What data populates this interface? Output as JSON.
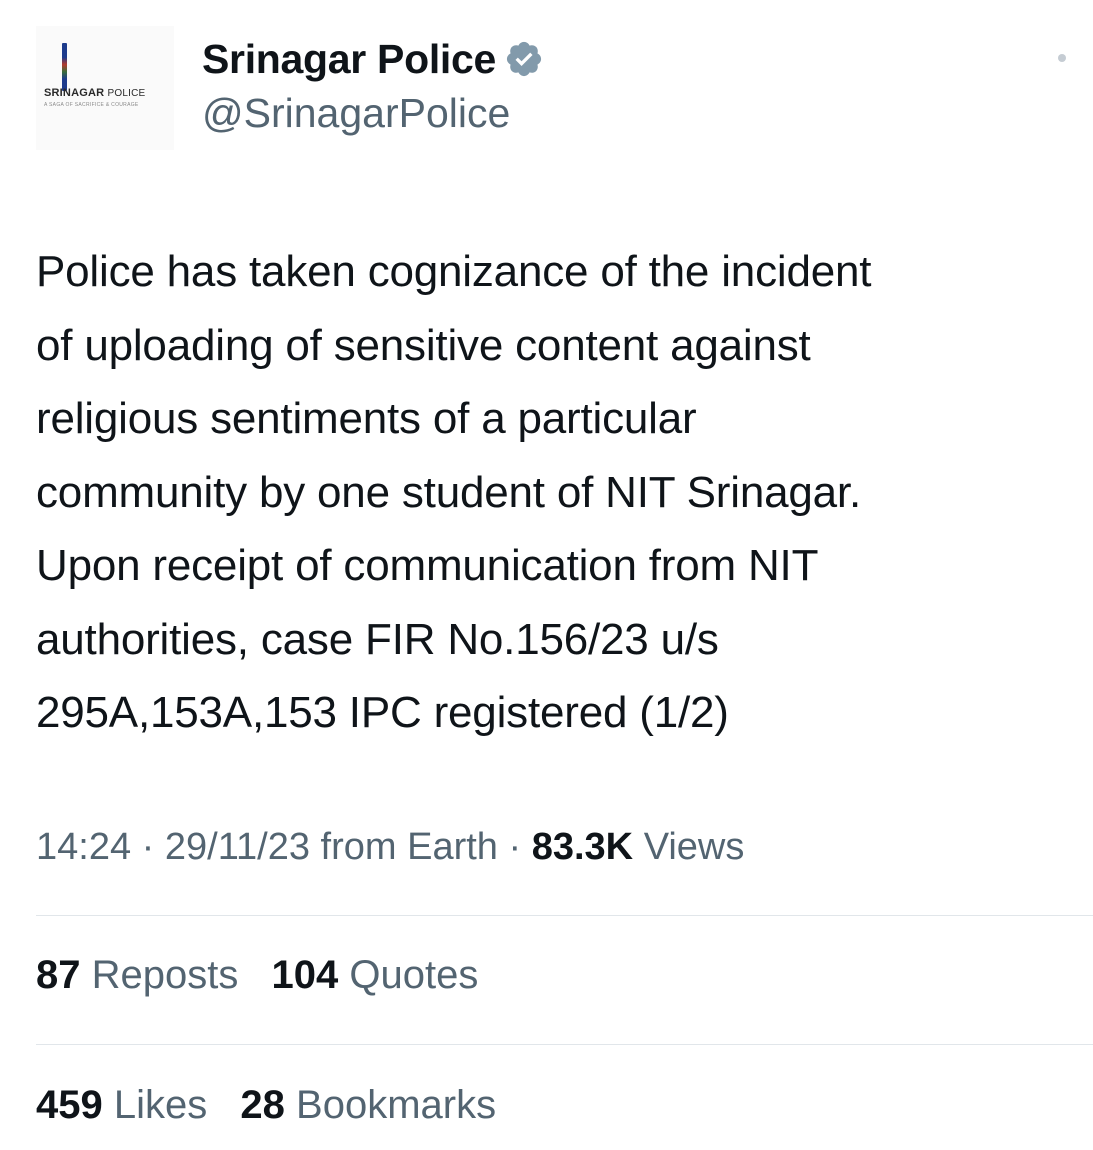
{
  "account": {
    "avatar_logo_bold": "SRINAGAR",
    "avatar_logo_light": "POLICE",
    "avatar_tagline": "A SAGA OF SACRIFICE & COURAGE",
    "display_name": "Srinagar Police",
    "handle": "@SrinagarPolice",
    "verified_icon": "verified-badge-icon",
    "verified_color": "#829aab"
  },
  "tweet": {
    "lines": [
      "Police has taken cognizance of the incident",
      "of uploading of sensitive content against",
      "religious sentiments of a particular",
      "community by one student of NIT Srinagar.",
      "Upon receipt of communication from NIT",
      "authorities, case FIR No.156/23 u/s",
      "295A,153A,153 IPC registered (1/2)"
    ]
  },
  "meta": {
    "time": "14:24",
    "sep1": "·",
    "date": "29/11/23",
    "source": "from Earth",
    "sep2": "·",
    "views_count": "83.3K",
    "views_label": "Views"
  },
  "stats": {
    "reposts_count": "87",
    "reposts_label": "Reposts",
    "quotes_count": "104",
    "quotes_label": "Quotes",
    "likes_count": "459",
    "likes_label": "Likes",
    "bookmarks_count": "28",
    "bookmarks_label": "Bookmarks"
  },
  "colors": {
    "text_primary": "#0f1419",
    "text_secondary": "#536471",
    "divider": "#e1e6ea"
  }
}
